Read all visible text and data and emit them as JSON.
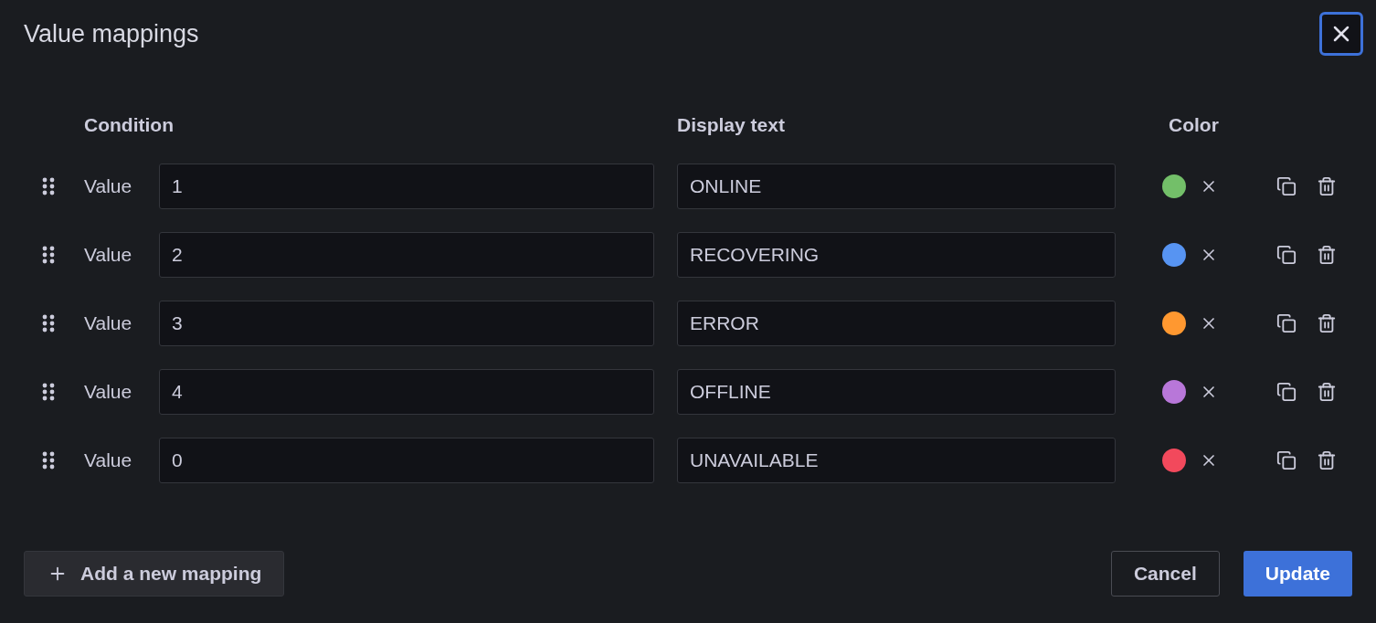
{
  "title": "Value mappings",
  "close_button": {
    "focused": true
  },
  "columns": [
    "Condition",
    "Display text",
    "Color"
  ],
  "mappings": [
    {
      "condition_label": "Value",
      "value": "1",
      "display_text": "ONLINE",
      "color": "#73bf69"
    },
    {
      "condition_label": "Value",
      "value": "2",
      "display_text": "RECOVERING",
      "color": "#5794f2"
    },
    {
      "condition_label": "Value",
      "value": "3",
      "display_text": "ERROR",
      "color": "#ff9830"
    },
    {
      "condition_label": "Value",
      "value": "4",
      "display_text": "OFFLINE",
      "color": "#b877d9"
    },
    {
      "condition_label": "Value",
      "value": "0",
      "display_text": "UNAVAILABLE",
      "color": "#f2495c"
    }
  ],
  "add_button": "Add a new mapping",
  "cancel_button": "Cancel",
  "update_button": "Update"
}
